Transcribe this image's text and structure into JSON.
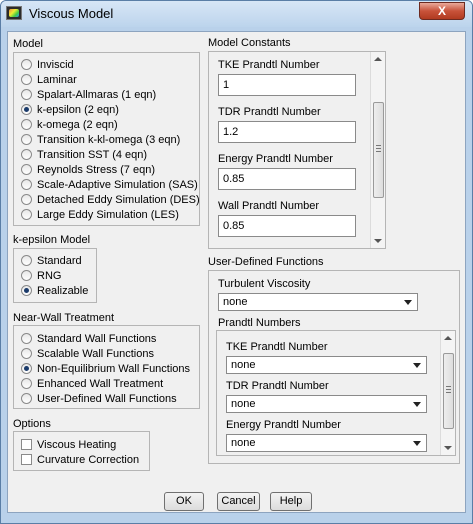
{
  "window": {
    "title": "Viscous Model",
    "close_label": "X"
  },
  "model": {
    "label": "Model",
    "options": [
      {
        "label": "Inviscid",
        "selected": false
      },
      {
        "label": "Laminar",
        "selected": false
      },
      {
        "label": "Spalart-Allmaras (1 eqn)",
        "selected": false
      },
      {
        "label": "k-epsilon (2 eqn)",
        "selected": true
      },
      {
        "label": "k-omega (2 eqn)",
        "selected": false
      },
      {
        "label": "Transition k-kl-omega (3 eqn)",
        "selected": false
      },
      {
        "label": "Transition SST (4 eqn)",
        "selected": false
      },
      {
        "label": "Reynolds Stress (7 eqn)",
        "selected": false
      },
      {
        "label": "Scale-Adaptive Simulation (SAS)",
        "selected": false
      },
      {
        "label": "Detached Eddy Simulation (DES)",
        "selected": false
      },
      {
        "label": "Large Eddy Simulation (LES)",
        "selected": false
      }
    ]
  },
  "kepsilon": {
    "label": "k-epsilon Model",
    "options": [
      {
        "label": "Standard",
        "selected": false
      },
      {
        "label": "RNG",
        "selected": false
      },
      {
        "label": "Realizable",
        "selected": true
      }
    ]
  },
  "nearwall": {
    "label": "Near-Wall Treatment",
    "options": [
      {
        "label": "Standard Wall Functions",
        "selected": false
      },
      {
        "label": "Scalable Wall Functions",
        "selected": false
      },
      {
        "label": "Non-Equilibrium Wall Functions",
        "selected": true
      },
      {
        "label": "Enhanced Wall Treatment",
        "selected": false
      },
      {
        "label": "User-Defined Wall Functions",
        "selected": false
      }
    ]
  },
  "options": {
    "label": "Options",
    "items": [
      {
        "label": "Viscous Heating",
        "checked": false
      },
      {
        "label": "Curvature Correction",
        "checked": false
      }
    ]
  },
  "constants": {
    "label": "Model Constants",
    "fields": [
      {
        "label": "TKE Prandtl Number",
        "value": "1"
      },
      {
        "label": "TDR Prandtl Number",
        "value": "1.2"
      },
      {
        "label": "Energy Prandtl Number",
        "value": "0.85"
      },
      {
        "label": "Wall Prandtl Number",
        "value": "0.85"
      }
    ]
  },
  "udf": {
    "label": "User-Defined Functions",
    "turbulent_viscosity": {
      "label": "Turbulent Viscosity",
      "value": "none"
    },
    "prandtl_label": "Prandtl Numbers",
    "prandtl": [
      {
        "label": "TKE Prandtl Number",
        "value": "none"
      },
      {
        "label": "TDR Prandtl Number",
        "value": "none"
      },
      {
        "label": "Energy Prandtl Number",
        "value": "none"
      }
    ]
  },
  "buttons": {
    "ok": "OK",
    "cancel": "Cancel",
    "help": "Help"
  }
}
